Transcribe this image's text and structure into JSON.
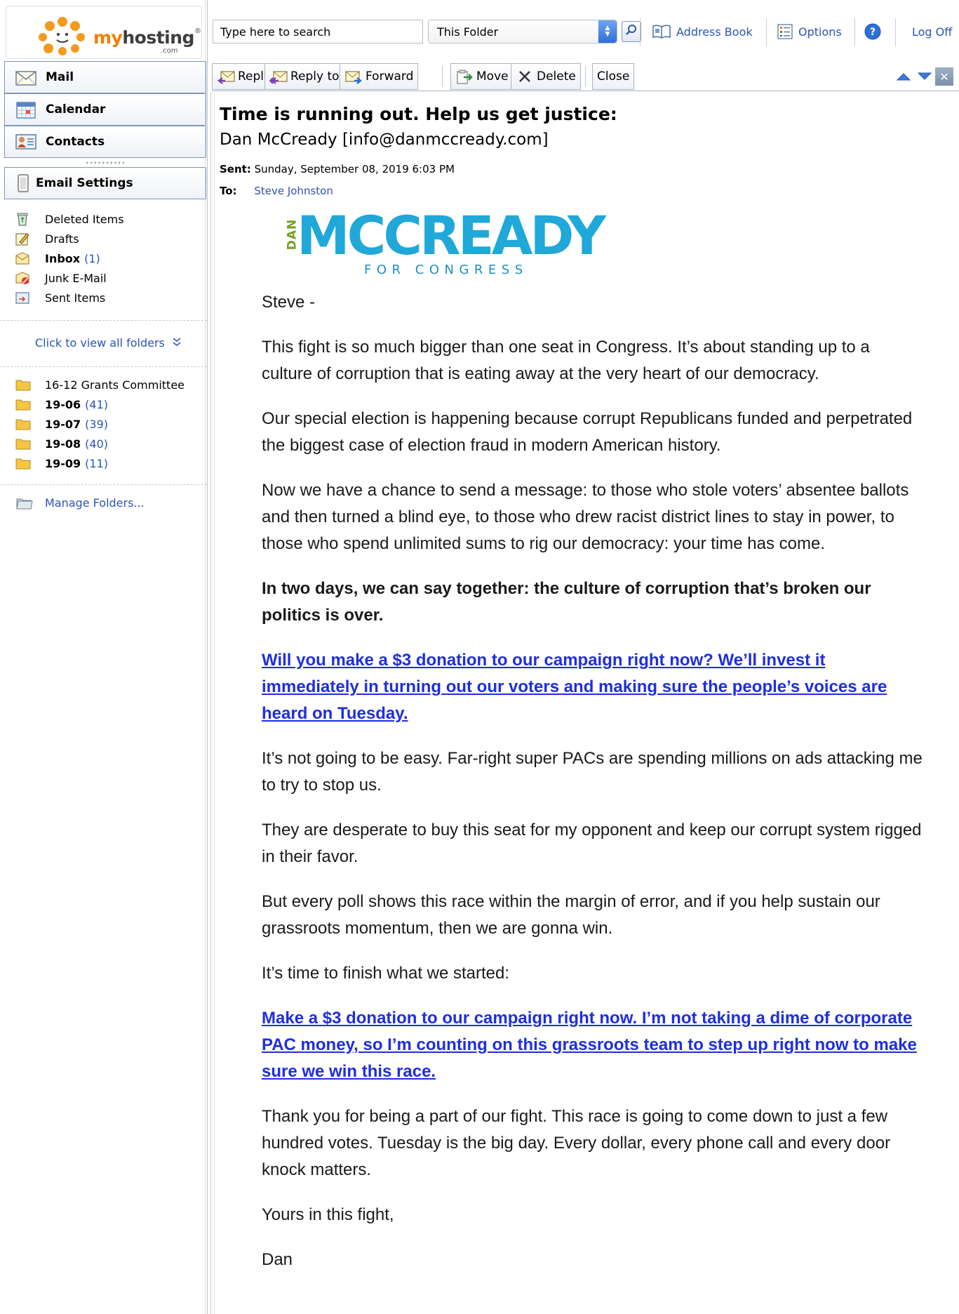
{
  "logo": {
    "name": "myhosting",
    "name_prefix": "my",
    "name_suffix": "hosting",
    "registered": "®",
    "tld": ".com"
  },
  "nav": {
    "mail": "Mail",
    "calendar": "Calendar",
    "contacts": "Contacts",
    "email_settings": "Email Settings"
  },
  "folders": [
    {
      "name": "Deleted Items",
      "bold": false,
      "count": "",
      "icon": "recycle-bin-icon"
    },
    {
      "name": "Drafts",
      "bold": false,
      "count": "",
      "icon": "draft-pencil-icon"
    },
    {
      "name": "Inbox",
      "bold": true,
      "count": "(1)",
      "icon": "inbox-icon"
    },
    {
      "name": "Junk E-Mail",
      "bold": false,
      "count": "",
      "icon": "junk-mail-icon"
    },
    {
      "name": "Sent Items",
      "bold": false,
      "count": "",
      "icon": "sent-items-icon"
    }
  ],
  "view_all_folders": "Click to view all folders",
  "custom_folders": [
    {
      "name": "16-12 Grants Committee",
      "bold": false,
      "count": ""
    },
    {
      "name": "19-06",
      "bold": true,
      "count": "(41)"
    },
    {
      "name": "19-07",
      "bold": true,
      "count": "(39)"
    },
    {
      "name": "19-08",
      "bold": true,
      "count": "(40)"
    },
    {
      "name": "19-09",
      "bold": true,
      "count": "(11)"
    }
  ],
  "manage_folders": "Manage Folders...",
  "search": {
    "placeholder": "Type here to search",
    "value": "Type here to search",
    "scope": "This Folder"
  },
  "top_links": {
    "address_book": "Address Book",
    "options": "Options",
    "log_off": "Log Off"
  },
  "toolbar": {
    "reply": "Reply",
    "reply_all": "Reply to All",
    "forward": "Forward",
    "move": "Move",
    "delete": "Delete",
    "close": "Close"
  },
  "message": {
    "subject": "Time is running out. Help us get justice:",
    "from": "Dan McCready [info@danmccready.com]",
    "sent_label": "Sent:",
    "sent_value": "Sunday, September 08, 2019 6:03 PM",
    "to_label": "To:",
    "to_value": "Steve Johnston",
    "brand_dan": "DAN",
    "brand_name": "MCCREADY",
    "brand_tagline": "FOR CONGRESS",
    "body": {
      "greeting": "Steve -",
      "p1": "This fight is so much bigger than one seat in Congress. It’s about standing up to a culture of corruption that is eating away at the very heart of our democracy.",
      "p2": "Our special election is happening because corrupt Republicans funded and perpetrated the biggest case of election fraud in modern American history.",
      "p3": "Now we have a chance to send a message: to those who stole voters’ absentee ballots and then turned a blind eye, to those who drew racist district lines to stay in power, to those who spend unlimited sums to rig our democracy: your time has come.",
      "p4": "In two days, we can say together: the culture of corruption that’s broken our politics is over.",
      "link1": "Will you make a $3 donation to our campaign right now? We’ll invest it immediately in turning out our voters and making sure the people’s voices are heard on Tuesday.",
      "p5": "It’s not going to be easy. Far-right super PACs are spending millions on ads attacking me to try to stop us.",
      "p6": "They are desperate to buy this seat for my opponent and keep our corrupt system rigged in their favor.",
      "p7": "But every poll shows this race within the margin of error, and if you help sustain our grassroots momentum, then we are gonna win.",
      "p8": "It’s time to finish what we started:",
      "link2": "Make a $3 donation to our campaign right now. I’m not taking a dime of corporate PAC money, so I’m counting on this grassroots team to step up right now to make sure we win this race.",
      "p9": "Thank you for being a part of our fight. This race is going to come down to just a few hundred votes. Tuesday is the big day. Every dollar, every phone call and every door knock matters.",
      "p10": "Yours in this fight,",
      "signoff": "Dan"
    }
  },
  "colors": {
    "link": "#2a54b5",
    "body_link": "#1e2ee0",
    "brand_blue": "#1fa8d8",
    "brand_green": "#73a022",
    "logo_orange": "#f07e00"
  }
}
